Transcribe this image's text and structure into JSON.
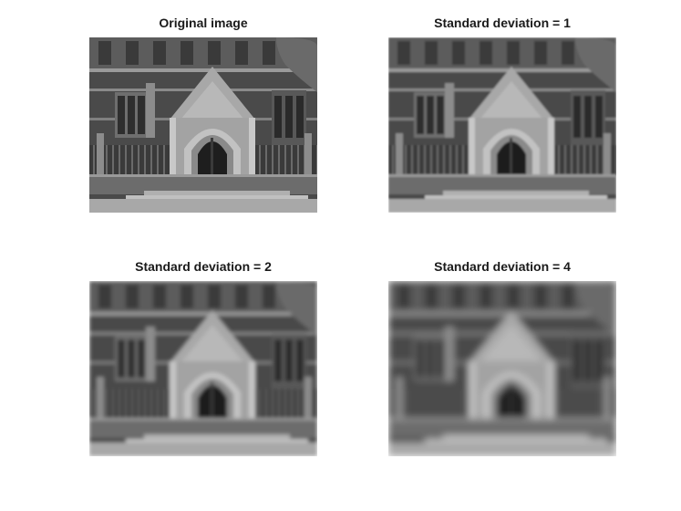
{
  "figure": {
    "panels": [
      {
        "title": "Original image",
        "blur": 0
      },
      {
        "title": "Standard deviation = 1",
        "blur": 1
      },
      {
        "title": "Standard deviation = 2",
        "blur": 2
      },
      {
        "title": "Standard deviation = 4",
        "blur": 4
      }
    ]
  }
}
